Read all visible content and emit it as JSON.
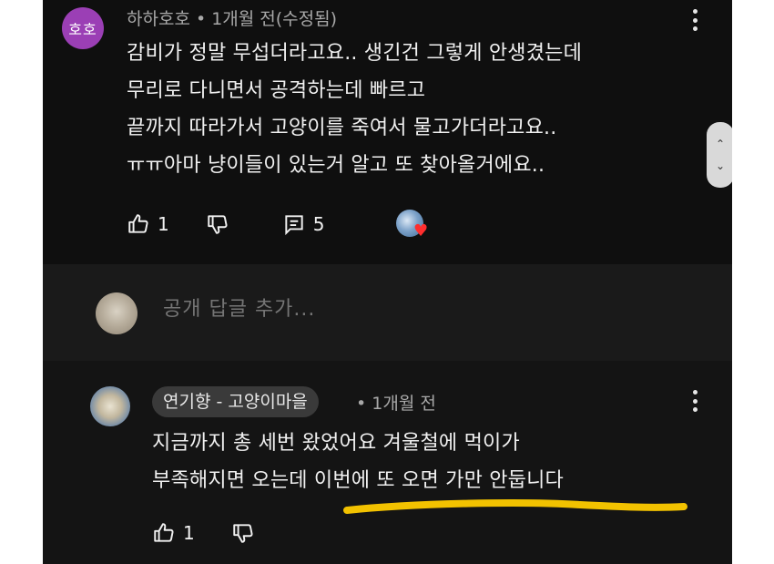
{
  "comment1": {
    "avatar_text": "호호",
    "meta": "하하호호 • 1개월 전(수정됨)",
    "lines": [
      "감비가 정말 무섭더라고요.. 생긴건 그렇게 안생겼는데",
      "무리로 다니면서 공격하는데 빠르고",
      "끝까지 따라가서 고양이를 죽여서 물고가더라고요..",
      "ㅠㅠ아마 냥이들이 있는거 알고 또 찾아올거에요.."
    ],
    "like_count": "1",
    "reply_count": "5",
    "creator_heart": "♥"
  },
  "reply_input": {
    "placeholder": "공개 답글 추가..."
  },
  "comment2": {
    "author_badge": "연기향 - 고양이마을",
    "meta": "• 1개월 전",
    "lines": [
      "지금까지 총 세번 왔었어요 겨울철에 먹이가",
      "부족해지면 오는데 이번에 또 오면 가만 안둡니다"
    ],
    "like_count": "1"
  },
  "scrollbar": {
    "up": "⌃",
    "down": "⌄"
  },
  "colors": {
    "background": "#0f0f0f",
    "reply_bar": "#1a1a1a",
    "avatar_purple": "#9b3fb5",
    "highlight_underline": "#f2c200",
    "heart": "#ff2e2e"
  },
  "icons": [
    "like-icon",
    "dislike-icon",
    "replies-icon",
    "more-options-icon",
    "heart-icon",
    "scroll-up-icon",
    "scroll-down-icon"
  ]
}
